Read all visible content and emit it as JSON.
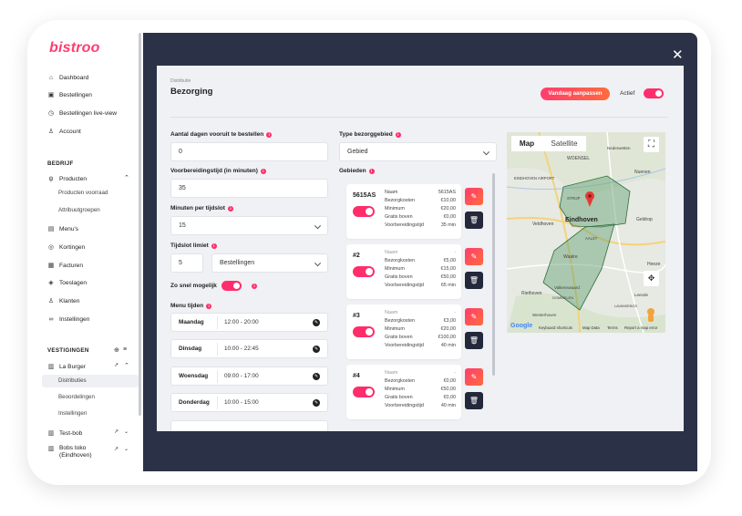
{
  "app": {
    "logo": "bistroo"
  },
  "sidebar": {
    "items": [
      {
        "label": "Dashboard",
        "icon": "home-icon"
      },
      {
        "label": "Bestellingen",
        "icon": "bag-icon"
      },
      {
        "label": "Bestellingen live-view",
        "icon": "clock-icon"
      },
      {
        "label": "Account",
        "icon": "user-icon"
      }
    ],
    "company_section": "BEDRIJF",
    "company_items": [
      {
        "label": "Producten",
        "icon": "fork-knife-icon"
      },
      {
        "label": "Menu's",
        "icon": "menu-icon"
      },
      {
        "label": "Kortingen",
        "icon": "discount-icon"
      },
      {
        "label": "Facturen",
        "icon": "invoice-icon"
      },
      {
        "label": "Toeslagen",
        "icon": "tag-icon"
      },
      {
        "label": "Klanten",
        "icon": "users-icon"
      },
      {
        "label": "Instellingen",
        "icon": "link-icon"
      }
    ],
    "producten_sub": [
      "Producten voorraad",
      "Attribuutgroepen"
    ],
    "locations_section": "VESTIGINGEN",
    "locations": [
      {
        "label": "La Burger"
      },
      {
        "label": "Test-bob"
      },
      {
        "label": "Bobs toko (Eindhoven)"
      }
    ],
    "laburger_sub": [
      "Distributies",
      "Beoordelingen",
      "Instellingen"
    ]
  },
  "modal": {
    "breadcrumb": "Distributie",
    "title": "Bezorging",
    "adjust_button": "Vandaag aanpassen",
    "active_label": "Actief",
    "days_ahead_label": "Aantal dagen vooruit te bestellen",
    "days_ahead_value": "0",
    "prep_time_label": "Voorbereidingstijd (in minuten)",
    "prep_time_value": "35",
    "minutes_per_slot_label": "Minuten per tijdslot",
    "minutes_per_slot_value": "15",
    "slot_limit_label": "Tijdslot limiet",
    "slot_limit_value": "5",
    "slot_limit_unit": "Bestellingen",
    "asap_label": "Zo snel mogelijk",
    "menu_times_label": "Menu tijden",
    "menu_times": [
      {
        "day": "Maandag",
        "time": "12:00 - 20:00"
      },
      {
        "day": "Dinsdag",
        "time": "10:00 - 22:45"
      },
      {
        "day": "Woensdag",
        "time": "09:00 - 17:00"
      },
      {
        "day": "Donderdag",
        "time": "10:00 - 15:00"
      }
    ],
    "zone_type_label": "Type bezorggebied",
    "zone_type_value": "Gebied",
    "zones_label": "Gebieden",
    "zones": [
      {
        "name": "5615AS",
        "rows": [
          [
            "Naam",
            "5615AS"
          ],
          [
            "Bezorgkosten",
            "€10,00"
          ],
          [
            "Minimum",
            "€20,00"
          ],
          [
            "Gratis boven",
            "€0,00"
          ],
          [
            "Voorbereidingstijd",
            "35 min"
          ]
        ]
      },
      {
        "name": "#2",
        "rows": [
          [
            "Naam",
            "-"
          ],
          [
            "Bezorgkosten",
            "€5,00"
          ],
          [
            "Minimum",
            "€15,00"
          ],
          [
            "Gratis boven",
            "€50,00"
          ],
          [
            "Voorbereidingstijd",
            "65 min"
          ]
        ]
      },
      {
        "name": "#3",
        "rows": [
          [
            "Naam",
            "-"
          ],
          [
            "Bezorgkosten",
            "€3,00"
          ],
          [
            "Minimum",
            "€20,00"
          ],
          [
            "Gratis boven",
            "€100,00"
          ],
          [
            "Voorbereidingstijd",
            "40 min"
          ]
        ]
      },
      {
        "name": "#4",
        "rows": [
          [
            "Naam",
            "-"
          ],
          [
            "Bezorgkosten",
            "€0,00"
          ],
          [
            "Minimum",
            "€50,00"
          ],
          [
            "Gratis boven",
            "€0,00"
          ],
          [
            "Voorbereidingstijd",
            "40 min"
          ]
        ]
      }
    ]
  },
  "map": {
    "tab_map": "Map",
    "tab_satellite": "Satellite",
    "city": "Eindhoven",
    "labels": [
      "Nederwetten",
      "WOENSEL",
      "Nuenen",
      "EINDHOVEN AIRPORT",
      "Veldhoven",
      "STRIJP",
      "Geldrop",
      "AALST",
      "Waalre",
      "Heeze",
      "Riethoven",
      "Valkenswaard",
      "DOMMELEN",
      "Westerhoven",
      "Leende",
      "LAVANSEBOS"
    ],
    "google": "Google",
    "attribution": [
      "Keyboard shortcuts",
      "Map Data",
      "Terms",
      "Report a map error"
    ]
  }
}
